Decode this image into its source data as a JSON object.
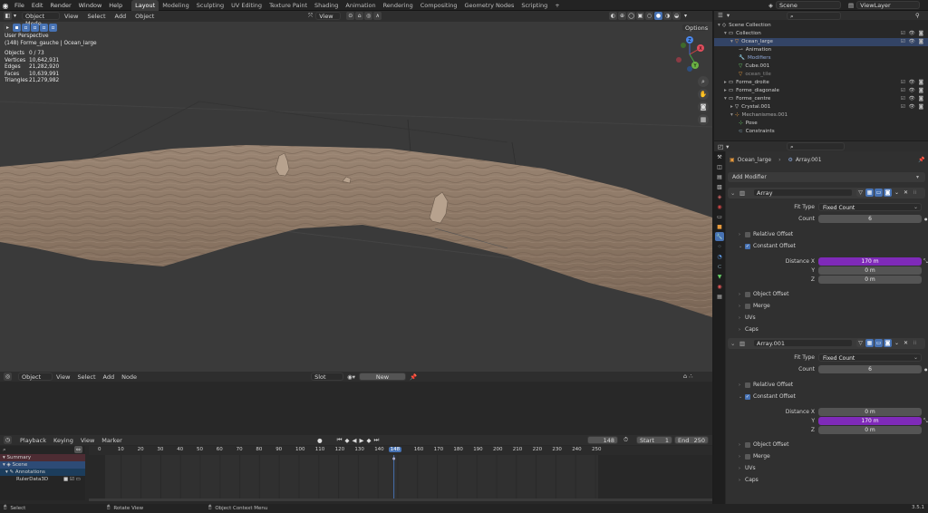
{
  "menu": {
    "items": [
      "File",
      "Edit",
      "Render",
      "Window",
      "Help"
    ]
  },
  "workspaces": {
    "tabs": [
      "Layout",
      "Modeling",
      "Sculpting",
      "UV Editing",
      "Texture Paint",
      "Shading",
      "Animation",
      "Rendering",
      "Compositing",
      "Geometry Nodes",
      "Scripting"
    ],
    "add": "+"
  },
  "scene": {
    "name": "Scene",
    "viewlayer": "ViewLayer"
  },
  "viewport": {
    "mode": "Object Mode",
    "menus": [
      "View",
      "Select",
      "Add",
      "Object"
    ],
    "transform": "View",
    "options": "Options",
    "view_name": "User Perspective",
    "context": "(148) Forme_gauche | Ocean_large",
    "stats": [
      {
        "k": "Objects",
        "v": "0 / 73"
      },
      {
        "k": "Vertices",
        "v": "10,642,931"
      },
      {
        "k": "Edges",
        "v": "21,282,920"
      },
      {
        "k": "Faces",
        "v": "10,639,991"
      },
      {
        "k": "Triangles",
        "v": "21,279,982"
      }
    ],
    "gizmo": {
      "x": "X",
      "y": "Y",
      "z": "Z"
    }
  },
  "shader_editor": {
    "mode": "Object",
    "menus": [
      "View",
      "Select",
      "Add",
      "Node"
    ],
    "slot": "Slot",
    "new": "New"
  },
  "timeline": {
    "menus": [
      "Playback",
      "Keying",
      "View",
      "Marker"
    ],
    "frame": "148",
    "start_label": "Start",
    "start": "1",
    "end_label": "End",
    "end": "250",
    "ticks": [
      "0",
      "10",
      "20",
      "30",
      "40",
      "50",
      "60",
      "70",
      "80",
      "90",
      "100",
      "110",
      "120",
      "130",
      "140",
      "148",
      "160",
      "170",
      "180",
      "190",
      "200",
      "210",
      "220",
      "230",
      "240",
      "250"
    ],
    "channels": [
      "Summary",
      "Scene",
      "Annotations",
      "RulerData3D"
    ]
  },
  "status": {
    "select": "Select",
    "rotate": "Rotate View",
    "context": "Object Context Menu",
    "version": "3.5.1"
  },
  "outliner": {
    "rows": [
      {
        "label": "Scene Collection",
        "indent": 0,
        "color": "#d0d0d0"
      },
      {
        "label": "Collection",
        "indent": 1,
        "color": "#d0d0d0"
      },
      {
        "label": "Ocean_large",
        "indent": 2,
        "color": "#d0d0d0"
      },
      {
        "label": "Animation",
        "indent": 3,
        "color": "#d0d0d0"
      },
      {
        "label": "Modifiers",
        "indent": 3,
        "color": "#8fa8d8"
      },
      {
        "label": "Cube.001",
        "indent": 3,
        "color": "#d0d0d0"
      },
      {
        "label": "ocean_tile",
        "indent": 3,
        "color": "#888888"
      },
      {
        "label": "Forme_droite",
        "indent": 1,
        "color": "#d0d0d0"
      },
      {
        "label": "Forme_diagonale",
        "indent": 1,
        "color": "#d0d0d0"
      },
      {
        "label": "Forme_centre",
        "indent": 1,
        "color": "#d0d0d0"
      },
      {
        "label": "Crystal.001",
        "indent": 2,
        "color": "#d0d0d0"
      },
      {
        "label": "Mechanismes.001",
        "indent": 2,
        "color": "#aaaaaa"
      },
      {
        "label": "Pose",
        "indent": 3,
        "color": "#d0d0d0"
      },
      {
        "label": "Constraints",
        "indent": 3,
        "color": "#d0d0d0"
      }
    ]
  },
  "properties": {
    "breadcrumb": {
      "object": "Ocean_large",
      "modifier": "Array.001"
    },
    "add_modifier": "Add Modifier",
    "mod1": {
      "name": "Array",
      "fit_type_label": "Fit Type",
      "fit_type": "Fixed Count",
      "count_label": "Count",
      "count": "6",
      "relative_offset": "Relative Offset",
      "constant_offset": "Constant Offset",
      "dist_x_label": "Distance X",
      "dist_x": "170 m",
      "y_label": "Y",
      "y": "0 m",
      "z_label": "Z",
      "z": "0 m",
      "object_offset": "Object Offset",
      "merge": "Merge",
      "uvs": "UVs",
      "caps": "Caps"
    },
    "mod2": {
      "name": "Array.001",
      "fit_type_label": "Fit Type",
      "fit_type": "Fixed Count",
      "count_label": "Count",
      "count": "6",
      "relative_offset": "Relative Offset",
      "constant_offset": "Constant Offset",
      "dist_x_label": "Distance X",
      "dist_x": "0 m",
      "y_label": "Y",
      "y": "170 m",
      "z_label": "Z",
      "z": "0 m",
      "object_offset": "Object Offset",
      "merge": "Merge",
      "uvs": "UVs",
      "caps": "Caps"
    }
  },
  "colors": {
    "accent": "#4772b3",
    "highlight": "#7f2ab9",
    "frame": "#4772b3"
  }
}
